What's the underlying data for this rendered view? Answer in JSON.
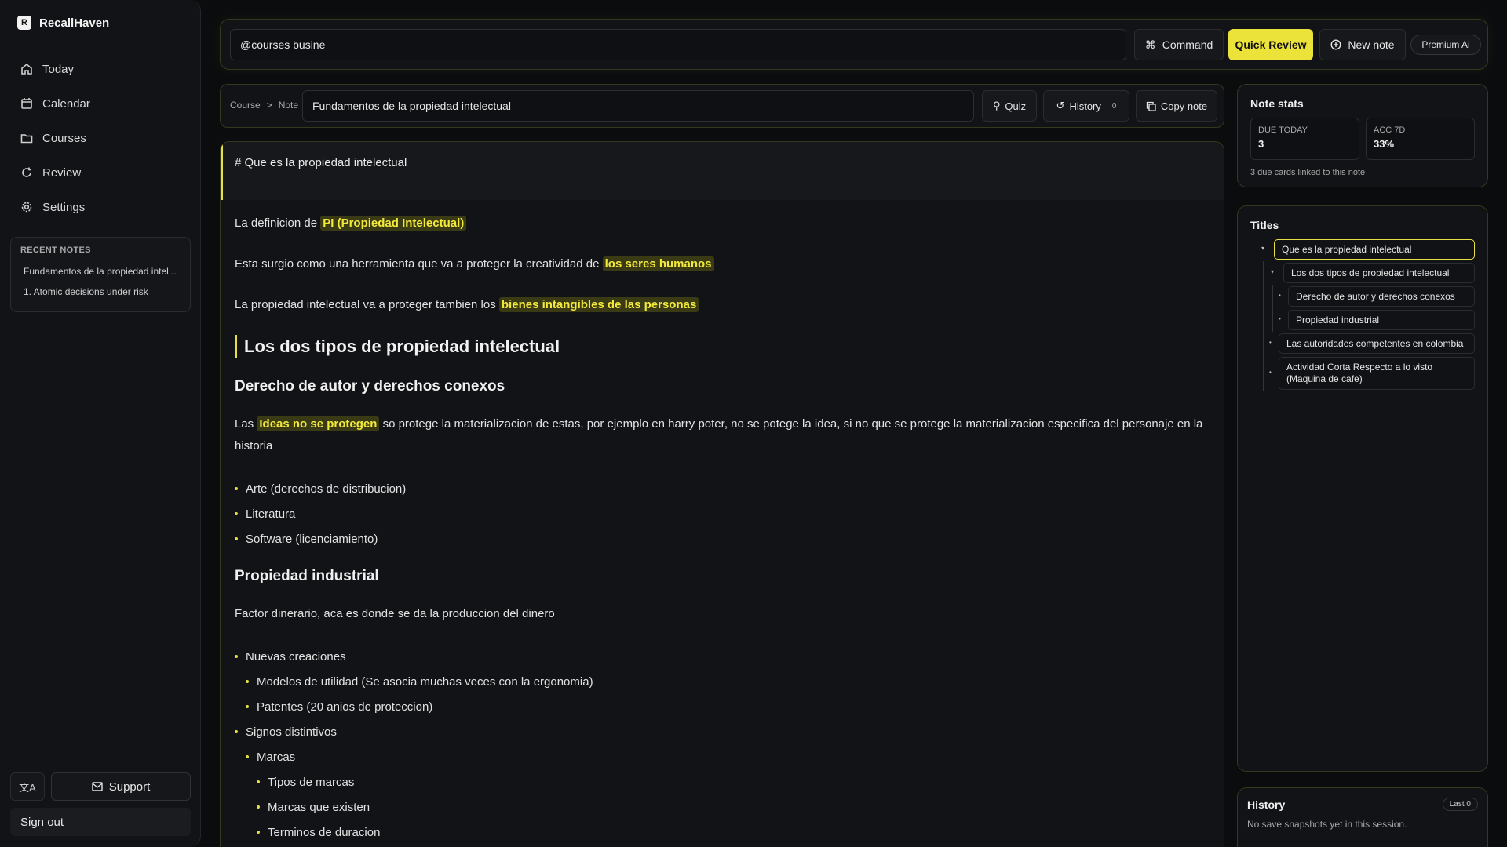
{
  "app": {
    "name": "RecallHaven",
    "logo_letter": "R"
  },
  "sidebar": {
    "nav": [
      {
        "label": "Today",
        "icon": "home-icon"
      },
      {
        "label": "Calendar",
        "icon": "calendar-icon"
      },
      {
        "label": "Courses",
        "icon": "folder-icon"
      },
      {
        "label": "Review",
        "icon": "refresh-icon"
      },
      {
        "label": "Settings",
        "icon": "gear-icon"
      }
    ],
    "recent_title": "RECENT NOTES",
    "recent": [
      "Fundamentos de la propiedad intel...",
      "1. Atomic decisions under risk"
    ],
    "support_label": "Support",
    "signout_label": "Sign out"
  },
  "topbar": {
    "search_value": "@courses busine",
    "command_label": "Command",
    "quick_review_label": "Quick Review",
    "new_note_label": "New note",
    "premium_label": "Premium Ai"
  },
  "notebar": {
    "crumb_course": "Course",
    "crumb_sep": ">",
    "crumb_note": "Note",
    "title_value": "Fundamentos de la propiedad intelectual",
    "quiz_label": "Quiz",
    "history_label": "History",
    "history_count": "0",
    "copy_label": "Copy note"
  },
  "editor": {
    "h1_raw": "# Que es la propiedad intelectual",
    "p1_pre": "La definicion de ",
    "p1_hl": "PI (Propiedad Intelectual)",
    "p2_pre": "Esta surgio como una herramienta que va a proteger la creatividad de ",
    "p2_hl": "los seres humanos",
    "p3_pre": "La propiedad intelectual va a proteger tambien los ",
    "p3_hl": "bienes intangibles de las personas",
    "h2": "Los dos tipos de propiedad intelectual",
    "h3a": "Derecho de autor y derechos conexos",
    "p4_pre": "Las ",
    "p4_hl": "Ideas no se protegen",
    "p4_post": " so protege la materializacion de estas, por ejemplo en harry poter, no se potege la idea, si no que se protege la materializacion especifica del personaje en la historia",
    "list1": [
      "Arte (derechos de distribucion)",
      "Literatura",
      "Software (licenciamiento)"
    ],
    "h3b": "Propiedad industrial",
    "p5": "Factor dinerario, aca es donde se da la produccion del dinero",
    "list2": {
      "a": "Nuevas creaciones",
      "a1": "Modelos de utilidad (Se asocia muchas veces con la ergonomia)",
      "a2": "Patentes (20 anios de proteccion)",
      "b": "Signos distintivos",
      "b1": "Marcas",
      "b1a": "Tipos de marcas",
      "b1b": "Marcas que existen",
      "b1c": "Terminos de duracion"
    }
  },
  "stats": {
    "title": "Note stats",
    "due_label": "DUE TODAY",
    "due_value": "3",
    "acc_label": "ACC 7D",
    "acc_value": "33%",
    "note": "3 due cards linked to this note"
  },
  "titles": {
    "title": "Titles",
    "items": [
      "Que es la propiedad intelectual",
      "Los dos tipos de propiedad intelectual",
      "Derecho de autor y derechos conexos",
      "Propiedad industrial",
      "Las autoridades competentes en colombia",
      "Actividad Corta Respecto a lo visto (Maquina de cafe)"
    ]
  },
  "history": {
    "title": "History",
    "pill": "Last 0",
    "empty": "No save snapshots yet in this session."
  },
  "colors": {
    "accent": "#ece33a",
    "background": "#0b0c0e",
    "panel": "#121316"
  }
}
